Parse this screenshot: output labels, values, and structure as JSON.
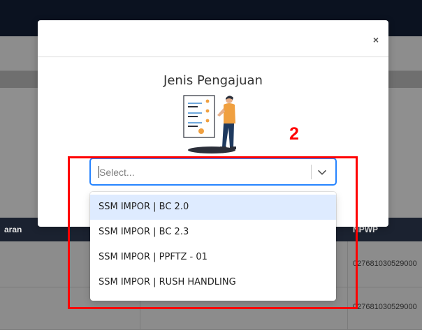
{
  "background": {
    "table_header_left": "aran",
    "table_header_right": "NPWP",
    "rows": [
      {
        "npwp": "027681030529000"
      },
      {
        "npwp": "027681030529000"
      }
    ]
  },
  "modal": {
    "close_symbol": "×",
    "title": "Jenis Pengajuan",
    "illustration": "document-form-person-illustration",
    "select": {
      "placeholder": "Select...",
      "chevron_icon": "chevron-down-icon"
    },
    "options": [
      {
        "label": "SSM IMPOR | BC 2.0",
        "focused": true
      },
      {
        "label": "SSM IMPOR | BC 2.3",
        "focused": false
      },
      {
        "label": "SSM IMPOR | PPFTZ - 01",
        "focused": false
      },
      {
        "label": "SSM IMPOR | RUSH HANDLING",
        "focused": false
      }
    ]
  },
  "annotation": {
    "label": "2",
    "color": "#ff0000"
  },
  "colors": {
    "focus_border": "#2684ff",
    "option_highlight": "#deebff",
    "accent_orange": "#f0a040"
  }
}
